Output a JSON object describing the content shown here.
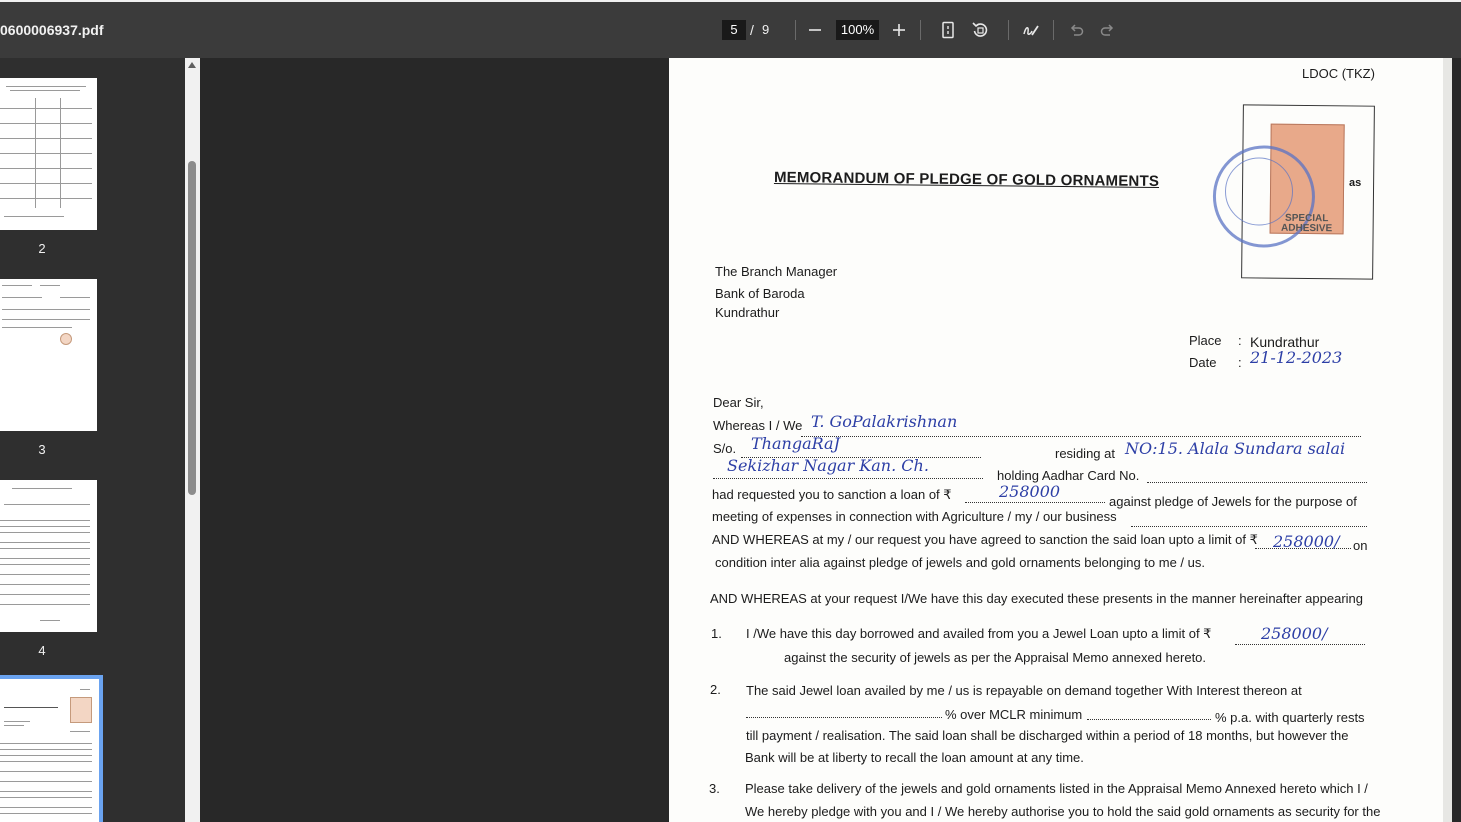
{
  "toolbar": {
    "filename": "0600006937.pdf",
    "current_page": "5",
    "page_separator": "/",
    "total_pages": "9",
    "zoom": "100%",
    "icons": [
      "zoom-out-icon",
      "zoom-in-icon",
      "fit-page-icon",
      "rotate-icon",
      "draw-icon",
      "undo-icon",
      "redo-icon"
    ]
  },
  "sidebar": {
    "thumbnails": [
      {
        "label": "2"
      },
      {
        "label": "3"
      },
      {
        "label": "4"
      }
    ],
    "selected_thumbnail_label": ""
  },
  "document": {
    "ref": "LDOC (TKZ)",
    "title": "MEMORANDUM OF PLEDGE OF GOLD ORNAMENTS",
    "stamp_as": "as",
    "stamp_text": "SPECIAL ADHESIVE",
    "addressee": [
      "The Branch Manager",
      "Bank of Baroda",
      "Kundrathur"
    ],
    "place_label": "Place",
    "place_colon": ":",
    "place_value": "Kundrathur",
    "date_label": "Date",
    "date_colon": ":",
    "date_value": "21-12-2023",
    "salutation": "Dear Sir,",
    "whereas_prefix": "Whereas I / We",
    "name_hand": "T. GoPalakrishnan",
    "so_prefix": "S/o.",
    "father_hand": "ThangaRaJ",
    "residing_label": "residing at",
    "address_hand_1": "NO:15. Alala Sundara salai",
    "address_hand_2": "Sekizhar Nagar Kan. Ch.",
    "aadhar_label": "holding Aadhar Card No.",
    "requested_prefix": "had requested you to sanction a loan of ₹",
    "loan_amount_hand": "258000",
    "against_text": "against pledge of Jewels for the purpose of",
    "meeting_text": "meeting of expenses in connection with Agriculture / my / our business",
    "and_whereas_1": "AND WHEREAS at my / our request you have agreed to sanction the said loan upto a limit of ₹",
    "limit_hand": "258000/",
    "on_text": "on",
    "condition_text": "condition inter alia against pledge of jewels  and gold ornaments belonging to me / us.",
    "and_whereas_2": "AND WHEREAS at your request I/We have this day executed these presents in the manner hereinafter appearing",
    "clause1_num": "1.",
    "clause1_line1": "I /We have this day borrowed and availed from you a Jewel Loan upto a limit of ₹",
    "clause1_amount_hand": "258000/",
    "clause1_line2": "against the security of jewels as per the Appraisal Memo annexed hereto.",
    "clause2_num": "2.",
    "clause2_line1": "The said Jewel loan availed by me / us is repayable on demand together With Interest thereon at",
    "clause2_line2a": "% over MCLR minimum",
    "clause2_line2b": "% p.a. with quarterly rests",
    "clause2_line3": "till payment / realisation. The said loan shall be discharged within a period of 18 months, but however the",
    "clause2_line4": "Bank will be at liberty to recall the loan amount at any time.",
    "clause3_num": "3.",
    "clause3_line1": "Please take delivery of the jewels and gold ornaments listed in the Appraisal Memo Annexed hereto which I /",
    "clause3_line2": "We hereby pledge with you and I / We hereby authorise you to hold the said gold ornaments as security for the"
  }
}
